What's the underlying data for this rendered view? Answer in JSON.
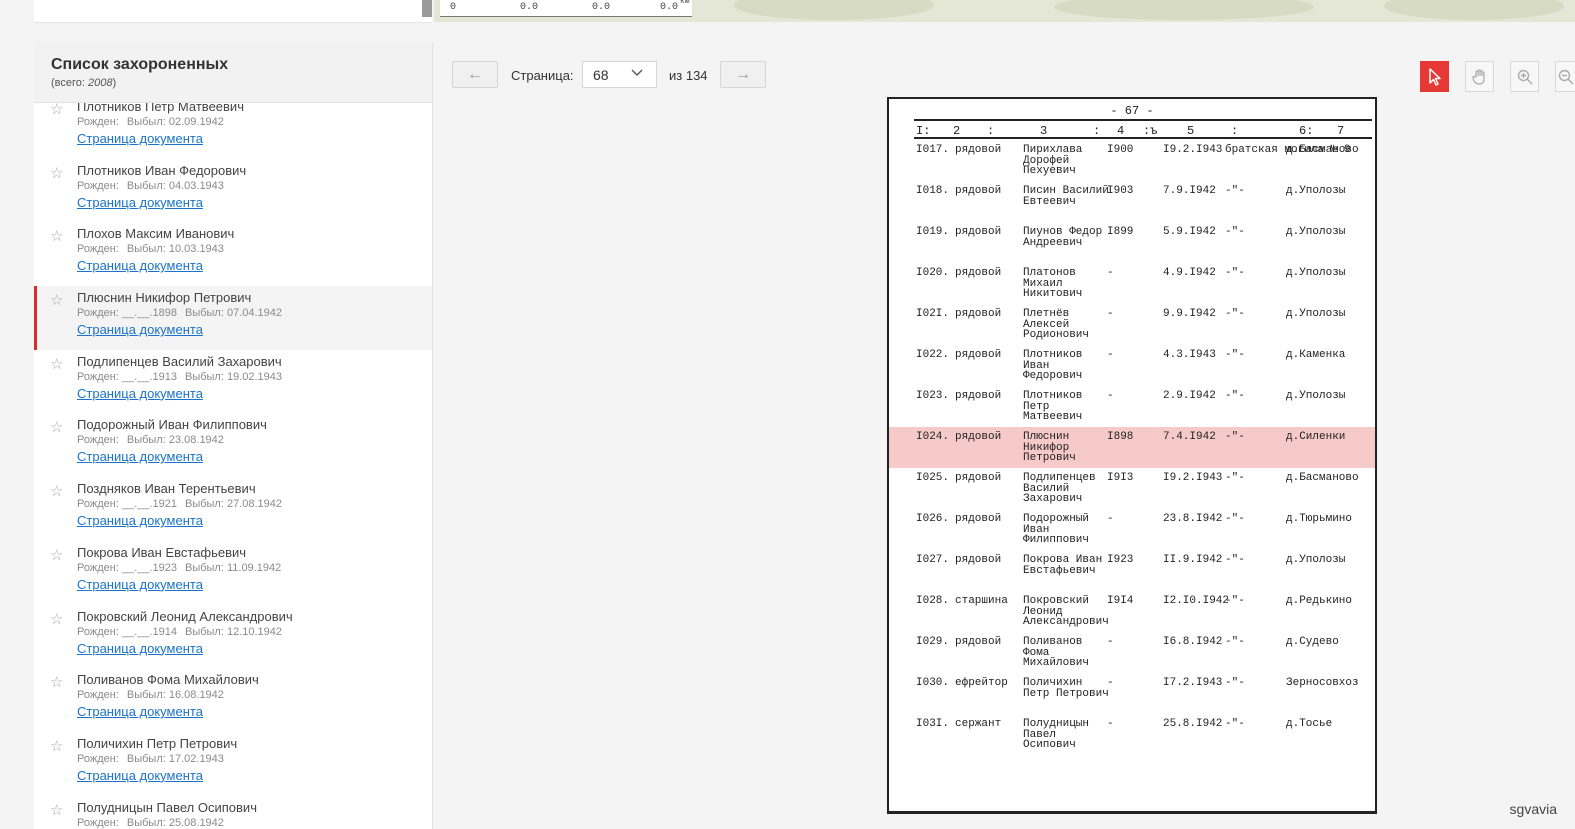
{
  "top": {
    "scale_labels": [
      "0",
      "0.0",
      "0.0",
      "0.0",
      "км"
    ]
  },
  "panel": {
    "title": "Список захороненных",
    "total_prefix": "(всего: ",
    "total_value": "2008",
    "total_suffix": ")"
  },
  "items": [
    {
      "name": "Плотников Петр Матвеевич",
      "born": "Рожден:",
      "died": "Выбыл: 02.09.1942",
      "link": "Страница документа",
      "active": false
    },
    {
      "name": "Плотников Иван Федорович",
      "born": "Рожден:",
      "died": "Выбыл: 04.03.1943",
      "link": "Страница документа",
      "active": false
    },
    {
      "name": "Плохов Максим Иванович",
      "born": "Рожден:",
      "died": "Выбыл: 10.03.1943",
      "link": "Страница документа",
      "active": false
    },
    {
      "name": "Плюснин Никифор Петрович",
      "born": "Рожден: __.__.1898",
      "died": "Выбыл: 07.04.1942",
      "link": "Страница документа",
      "active": true
    },
    {
      "name": "Подлипенцев Василий Захарович",
      "born": "Рожден: __.__.1913",
      "died": "Выбыл: 19.02.1943",
      "link": "Страница документа",
      "active": false
    },
    {
      "name": "Подорожный Иван Филиппович",
      "born": "Рожден:",
      "died": "Выбыл: 23.08.1942",
      "link": "Страница документа",
      "active": false
    },
    {
      "name": "Поздняков Иван Терентьевич",
      "born": "Рожден: __.__.1921",
      "died": "Выбыл: 27.08.1942",
      "link": "Страница документа",
      "active": false
    },
    {
      "name": "Покрова Иван Евстафьевич",
      "born": "Рожден: __.__.1923",
      "died": "Выбыл: 11.09.1942",
      "link": "Страница документа",
      "active": false
    },
    {
      "name": "Покровский Леонид Александрович",
      "born": "Рожден: __.__.1914",
      "died": "Выбыл: 12.10.1942",
      "link": "Страница документа",
      "active": false
    },
    {
      "name": "Поливанов Фома Михайлович",
      "born": "Рожден:",
      "died": "Выбыл: 16.08.1942",
      "link": "Страница документа",
      "active": false
    },
    {
      "name": "Поличихин Петр Петрович",
      "born": "Рожден:",
      "died": "Выбыл: 17.02.1943",
      "link": "Страница документа",
      "active": false
    },
    {
      "name": "Полудницын Павел Осипович",
      "born": "Рожден:",
      "died": "Выбыл: 25.08.1942",
      "link": "Страница документа",
      "active": false
    }
  ],
  "pager": {
    "prev_icon": "←",
    "label": "Страница:",
    "current": "68",
    "of": "из 134",
    "next_icon": "→"
  },
  "tools": [
    "cursor-icon",
    "hand-icon",
    "zoom-in-icon",
    "zoom-out-icon"
  ],
  "doc": {
    "page_number": "- 67 -",
    "headers": [
      "I:",
      "2",
      ":",
      "3",
      ":",
      "4",
      ":ъ",
      "5",
      ":",
      "6:",
      "7"
    ],
    "rows": [
      {
        "num": "I017.",
        "rank": "рядовой",
        "name": "Пирихлава Дорофей Пехуевич",
        "year": "I900",
        "date": "I9.2.I943",
        "grave": "братская могила № 9",
        "place": "д.Басманово"
      },
      {
        "num": "I018.",
        "rank": "рядовой",
        "name": "Писин Василий Евтеевич",
        "year": "I903",
        "date": "7.9.I942",
        "grave": "-\"-",
        "place": "д.Уполозы"
      },
      {
        "num": "I019.",
        "rank": "рядовой",
        "name": "Пиунов Федор Андреевич",
        "year": "I899",
        "date": "5.9.I942",
        "grave": "-\"-",
        "place": "д.Уполозы"
      },
      {
        "num": "I020.",
        "rank": "рядовой",
        "name": "Платонов Михаил Никитович",
        "year": "-",
        "date": "4.9.I942",
        "grave": "-\"-",
        "place": "д.Уполозы"
      },
      {
        "num": "I02I.",
        "rank": "рядовой",
        "name": "Плетнёв Алексей Родионович",
        "year": "-",
        "date": "9.9.I942",
        "grave": "-\"-",
        "place": "д.Уполозы"
      },
      {
        "num": "I022.",
        "rank": "рядовой",
        "name": "Плотников Иван Федорович",
        "year": "-",
        "date": "4.3.I943",
        "grave": "-\"-",
        "place": "д.Каменка"
      },
      {
        "num": "I023.",
        "rank": "рядовой",
        "name": "Плотников Петр Матвеевич",
        "year": "-",
        "date": "2.9.I942",
        "grave": "-\"-",
        "place": "д.Уполозы"
      },
      {
        "num": "I024.",
        "rank": "рядовой",
        "name": "Плюснин Никифор Петрович",
        "year": "I898",
        "date": "7.4.I942",
        "grave": "-\"-",
        "place": "д.Силенки",
        "highlight": true
      },
      {
        "num": "I025.",
        "rank": "рядовой",
        "name": "Подлипенцев Василий Захарович",
        "year": "I9I3",
        "date": "I9.2.I943",
        "grave": "-\"-",
        "place": "д.Басманово"
      },
      {
        "num": "I026.",
        "rank": "рядовой",
        "name": "Подорожный Иван Филиппович",
        "year": "-",
        "date": "23.8.I942",
        "grave": "-\"-",
        "place": "д.Тюрьмино"
      },
      {
        "num": "I027.",
        "rank": "рядовой",
        "name": "Покрова Иван Евстафьевич",
        "year": "I923",
        "date": "II.9.I942",
        "grave": "-\"-",
        "place": "д.Уполозы"
      },
      {
        "num": "I028.",
        "rank": "старшина",
        "name": "Покровский Леонид Александрович",
        "year": "I9I4",
        "date": "I2.I0.I942",
        "grave": "-\"-",
        "place": "д.Редькино"
      },
      {
        "num": "I029.",
        "rank": "рядовой",
        "name": "Поливанов Фома Михайлович",
        "year": "-",
        "date": "I6.8.I942",
        "grave": "-\"-",
        "place": "д.Судево"
      },
      {
        "num": "I030.",
        "rank": "ефрейтор",
        "name": "Поличихин Петр Петрович",
        "year": "-",
        "date": "I7.2.I943",
        "grave": "-\"-",
        "place": "Зерносовхоз"
      },
      {
        "num": "I03I.",
        "rank": "сержант",
        "name": "Полудницын Павел Осипович",
        "year": "-",
        "date": "25.8.I942",
        "grave": "-\"-",
        "place": "д.Тосье"
      }
    ]
  },
  "watermark": "sgvavia",
  "colors": {
    "accent": "#e53935",
    "link": "#1a73c8",
    "highlight": "#f7caca"
  }
}
